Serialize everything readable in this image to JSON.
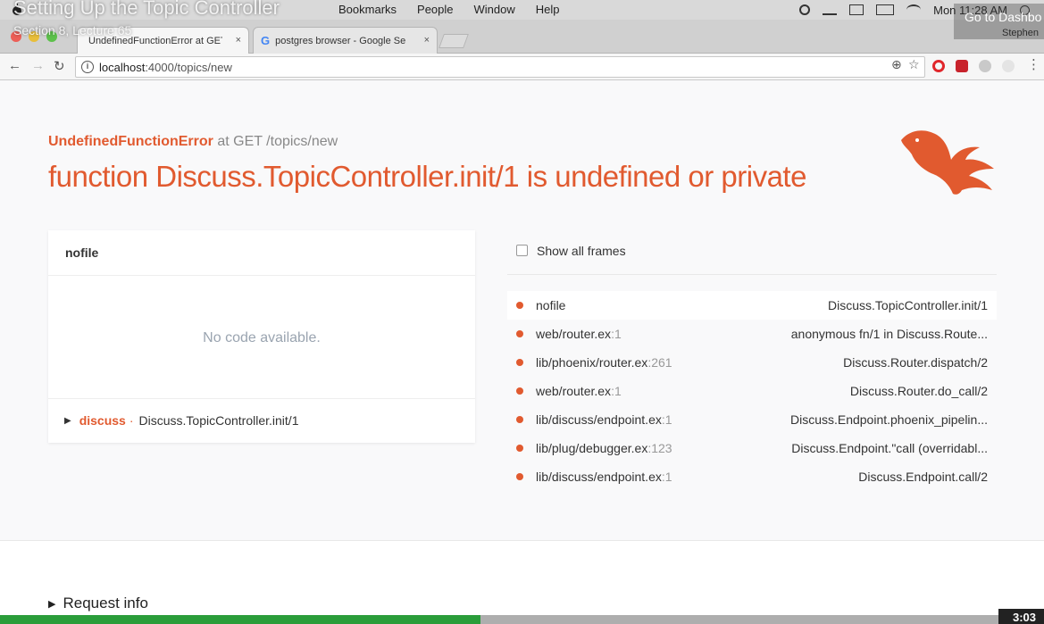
{
  "menubar": {
    "menus": [
      "Bookmarks",
      "People",
      "Window",
      "Help"
    ],
    "clock": "Mon 11:28 AM"
  },
  "overlay": {
    "title": "Setting Up the Topic Controller",
    "subtitle": "Section 8, Lecture 65",
    "dashboard_link": "Go to Dashbo",
    "timecode": "3:03",
    "progress_percent": 46
  },
  "browser": {
    "tabs": [
      {
        "title": "UndefinedFunctionError at GET",
        "close": "×"
      },
      {
        "title": "postgres browser - Google Se",
        "close": "×"
      }
    ],
    "profile": "Stephen",
    "url_host": "localhost",
    "url_path": ":4000/topics/new"
  },
  "error": {
    "type": "UndefinedFunctionError",
    "location": "at GET /topics/new",
    "message": "function Discuss.TopicController.init/1 is undefined or private"
  },
  "code_panel": {
    "file": "nofile",
    "empty_text": "No code available.",
    "context_app": "discuss",
    "context_sep": "·",
    "context_fn": "Discuss.TopicController.init/1"
  },
  "frames": {
    "toggle_label": "Show all frames",
    "items": [
      {
        "file": "nofile",
        "line": "",
        "fn": "Discuss.TopicController.init/1"
      },
      {
        "file": "web/router.ex",
        "line": ":1",
        "fn": "anonymous fn/1 in Discuss.Route..."
      },
      {
        "file": "lib/phoenix/router.ex",
        "line": ":261",
        "fn": "Discuss.Router.dispatch/2"
      },
      {
        "file": "web/router.ex",
        "line": ":1",
        "fn": "Discuss.Router.do_call/2"
      },
      {
        "file": "lib/discuss/endpoint.ex",
        "line": ":1",
        "fn": "Discuss.Endpoint.phoenix_pipelin..."
      },
      {
        "file": "lib/plug/debugger.ex",
        "line": ":123",
        "fn": "Discuss.Endpoint.\"call (overridabl..."
      },
      {
        "file": "lib/discuss/endpoint.ex",
        "line": ":1",
        "fn": "Discuss.Endpoint.call/2"
      }
    ]
  },
  "request_info": {
    "label": "Request info"
  },
  "colors": {
    "accent": "#e15a2f",
    "progress": "#2a9d3a"
  },
  "icons": [
    "apple-icon",
    "back-icon",
    "forward-icon",
    "reload-icon",
    "info-icon",
    "zoom-icon",
    "star-icon",
    "phoenix-logo-icon"
  ]
}
